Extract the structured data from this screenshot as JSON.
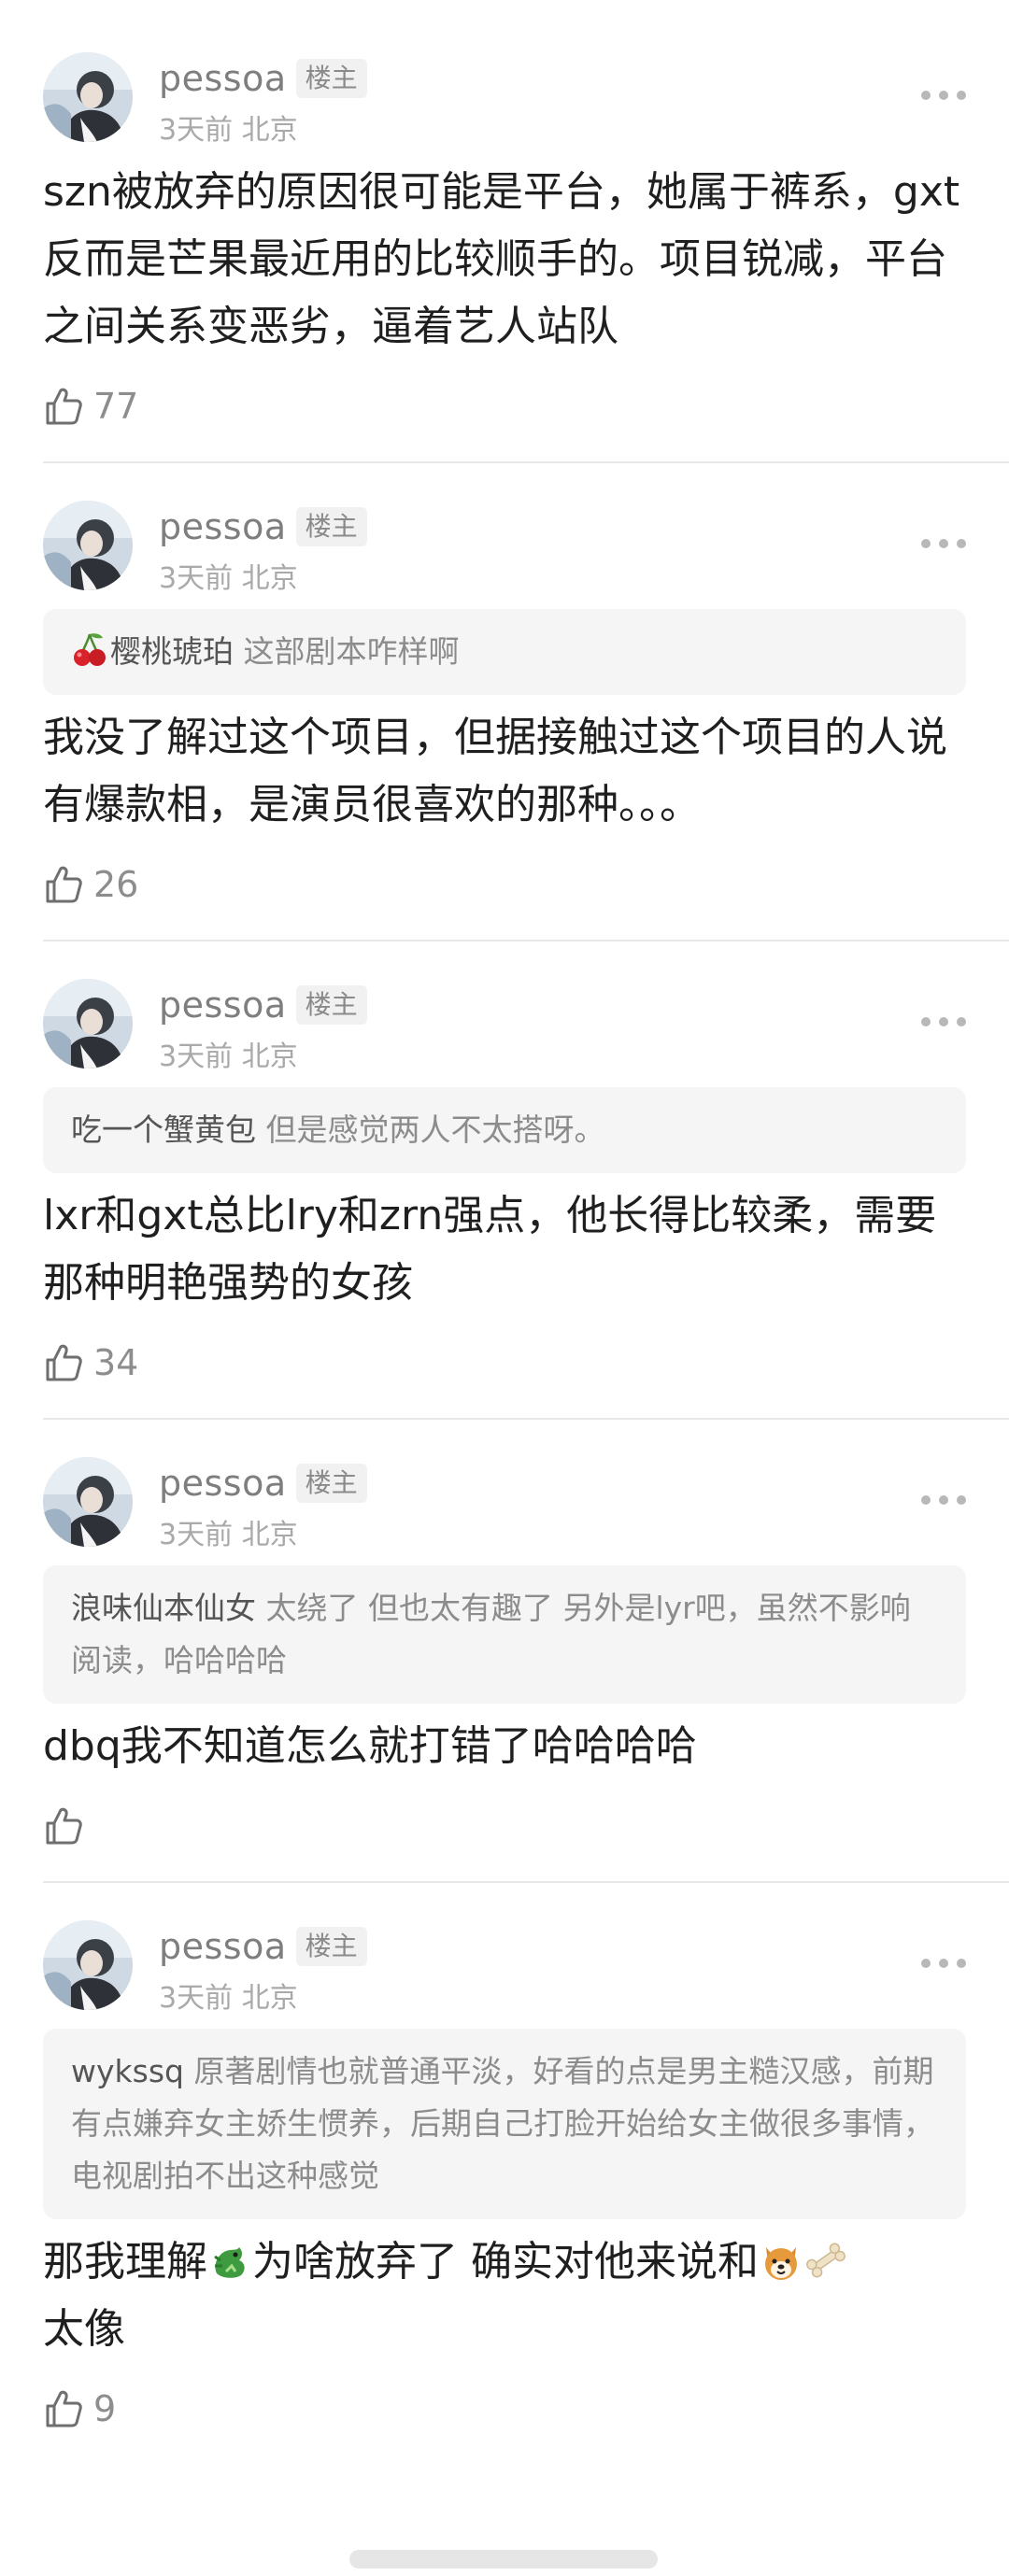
{
  "comments": [
    {
      "username": "pessoa",
      "badge": "楼主",
      "time": "3天前",
      "location": "北京",
      "quote": null,
      "text": "szn被放弃的原因很可能是平台，她属于裤系，gxt反而是芒果最近用的比较顺手的。项目锐减，平台之间关系变恶劣，逼着艺人站队",
      "likes": "77"
    },
    {
      "username": "pessoa",
      "badge": "楼主",
      "time": "3天前",
      "location": "北京",
      "quote": {
        "name": "樱桃琥珀",
        "text": "这部剧本咋样啊",
        "icon": "cherry-emoji"
      },
      "text": "我没了解过这个项目，但据接触过这个项目的人说有爆款相，是演员很喜欢的那种。。。",
      "likes": "26"
    },
    {
      "username": "pessoa",
      "badge": "楼主",
      "time": "3天前",
      "location": "北京",
      "quote": {
        "name": "吃一个蟹黄包",
        "text": "但是感觉两人不太搭呀。"
      },
      "text": "lxr和gxt总比lry和zrn强点，他长得比较柔，需要那种明艳强势的女孩",
      "likes": "34"
    },
    {
      "username": "pessoa",
      "badge": "楼主",
      "time": "3天前",
      "location": "北京",
      "quote": {
        "name": "浪味仙本仙女",
        "text": "太绕了 但也太有趣了  另外是lyr吧，虽然不影响阅读，哈哈哈哈"
      },
      "text": "dbq我不知道怎么就打错了哈哈哈哈",
      "likes": ""
    },
    {
      "username": "pessoa",
      "badge": "楼主",
      "time": "3天前",
      "location": "北京",
      "quote": {
        "name": "wykssq",
        "text": "原著剧情也就普通平淡，好看的点是男主糙汉感，前期有点嫌弃女主娇生惯养，后期自己打脸开始给女主做很多事情，电视剧拍不出这种感觉"
      },
      "text_a": "那我理解",
      "text_b": "为啥放弃了 确实对他来说和",
      "text_c": "太像",
      "emojis": [
        "dragon-emoji",
        "dog-face-emoji",
        "bone-emoji"
      ],
      "likes": "9"
    }
  ]
}
